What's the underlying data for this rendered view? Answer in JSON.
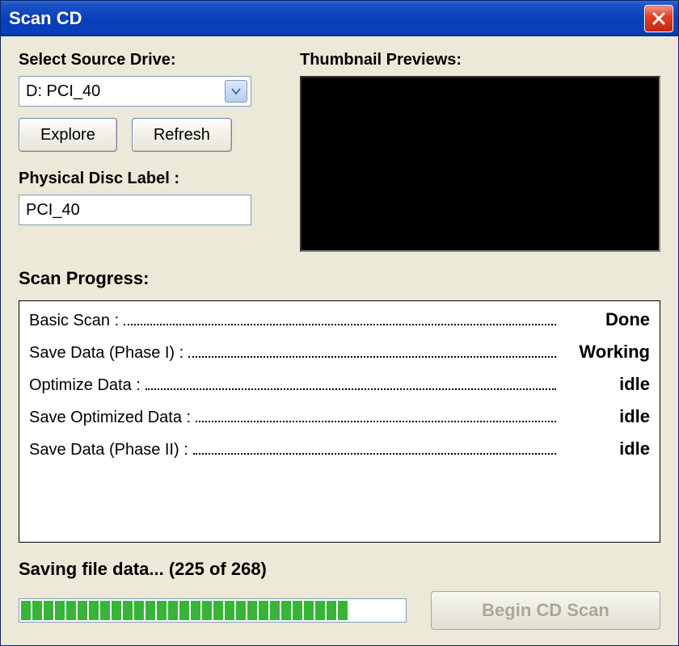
{
  "window": {
    "title": "Scan CD"
  },
  "source": {
    "label": "Select Source Drive:",
    "selected": "D: PCI_40",
    "explore": "Explore",
    "refresh": "Refresh"
  },
  "disc_label": {
    "label": "Physical Disc Label :",
    "value": "PCI_40"
  },
  "thumbnails": {
    "label": "Thumbnail Previews:"
  },
  "scan": {
    "heading": "Scan Progress:",
    "rows": [
      {
        "label": "Basic Scan :",
        "status": "Done"
      },
      {
        "label": "Save Data (Phase I)  :",
        "status": "Working"
      },
      {
        "label": "Optimize Data :",
        "status": "idle"
      },
      {
        "label": "Save Optimized Data :",
        "status": "idle"
      },
      {
        "label": "Save Data (Phase II)  :",
        "status": "idle"
      }
    ],
    "status_text": "Saving file data... (225 of 268)",
    "progress": {
      "current": 225,
      "total": 268
    }
  },
  "buttons": {
    "begin": "Begin CD Scan"
  },
  "colors": {
    "titlebar": "#0a3fbb",
    "close": "#e2412a",
    "progress": "#38b438"
  }
}
